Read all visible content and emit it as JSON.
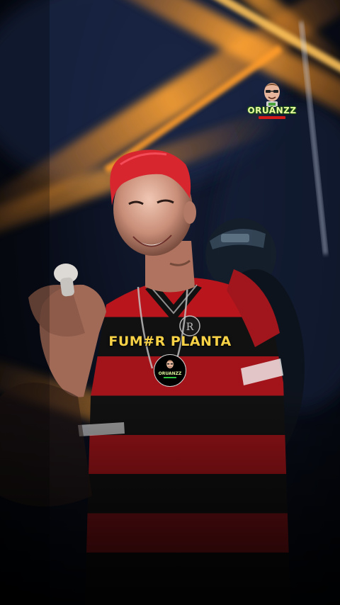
{
  "caption": "FUM#R PLANTA",
  "watermark": {
    "brand": "ORUANZZ"
  },
  "colors": {
    "caption": "#f7d146",
    "light_beams": "#ff8a1c",
    "jersey_red": "#b8161c",
    "jersey_black": "#111111",
    "hair": "#d8262f"
  }
}
